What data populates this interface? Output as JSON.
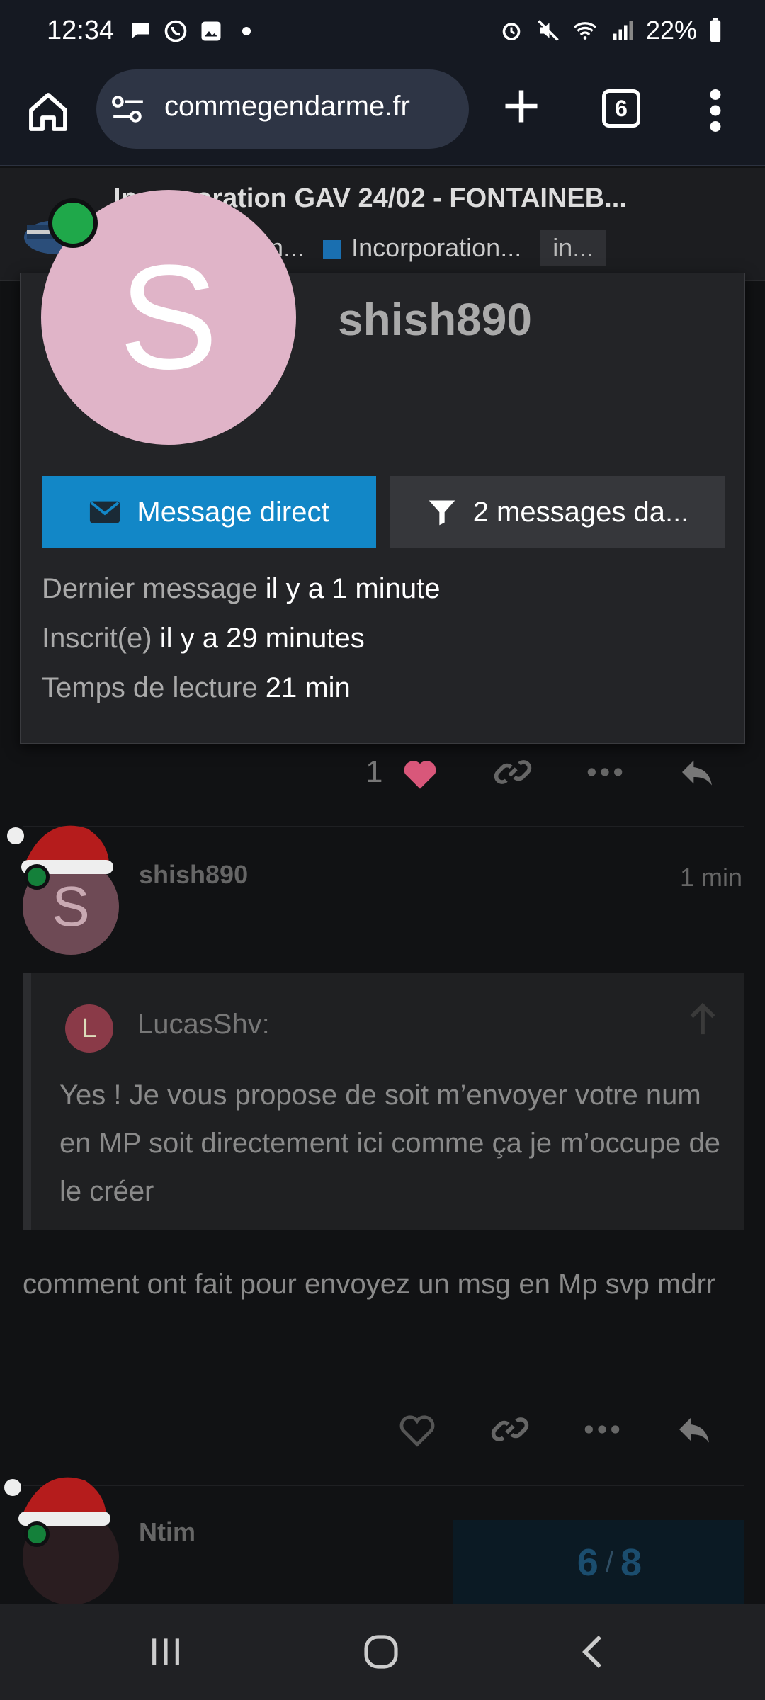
{
  "status_bar": {
    "time": "12:34",
    "battery": "22%"
  },
  "browser": {
    "url": "commegendarme.fr",
    "tab_count": "6"
  },
  "topic": {
    "title": "Incorporation GAV 24/02 - FONTAINEB...",
    "categories": [
      "Adjoin...",
      "Incorporation..."
    ],
    "tag": "in..."
  },
  "user_card": {
    "avatar_letter": "S",
    "username": "shish890",
    "message_button": "Message direct",
    "filter_button": "2 messages da...",
    "stats": [
      {
        "label": "Dernier message",
        "value": "il y a 1 minute"
      },
      {
        "label": "Inscrit(e)",
        "value": "il y a 29 minutes"
      },
      {
        "label": "Temps de lecture",
        "value": "21 min"
      }
    ]
  },
  "post1": {
    "like_count": "1"
  },
  "post2": {
    "avatar_letter": "S",
    "username": "shish890",
    "time": "1 min",
    "quote": {
      "avatar_letter": "L",
      "username": "LucasShv:",
      "text": "Yes ! Je vous propose de soit m’envoyer votre num en MP soit directement ici comme ça je m’occupe de le créer"
    },
    "body": "comment ont fait pour envoyez un msg en Mp svp mdrr"
  },
  "post3": {
    "username": "Ntim"
  },
  "progress": {
    "current": "6",
    "separator": "/",
    "total": "8"
  },
  "colors": {
    "accent": "#1287c7",
    "online": "#1fa84a",
    "like": "#d9577a"
  }
}
